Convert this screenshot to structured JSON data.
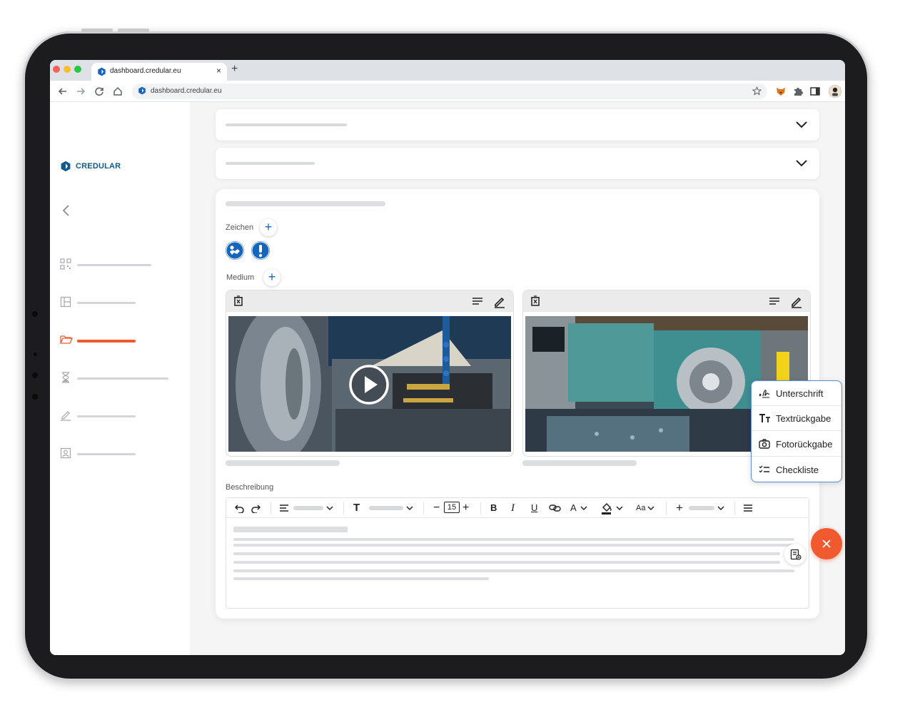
{
  "browser": {
    "tab_title": "dashboard.credular.eu",
    "url": "dashboard.credular.eu",
    "new_tab": "+",
    "close_tab": "×"
  },
  "sidebar": {
    "logo_text": "CREDULAR",
    "items": [
      {
        "icon": "qr-code-icon",
        "active": false
      },
      {
        "icon": "layout-icon",
        "active": false
      },
      {
        "icon": "folder-open-icon",
        "active": true
      },
      {
        "icon": "hourglass-icon",
        "active": false
      },
      {
        "icon": "signature-pen-icon",
        "active": false
      },
      {
        "icon": "id-card-icon",
        "active": false
      }
    ],
    "active_color": "#f15a2e"
  },
  "card": {
    "signs_label": "Zeichen",
    "medium_label": "Medium",
    "description_label": "Beschreibung",
    "add_symbol": "+",
    "signs": [
      "ppe-sign-icon",
      "warning-sign-icon"
    ],
    "media": [
      {
        "type": "video",
        "icons": [
          "delete-icon",
          "text-lines-icon",
          "edit-pencil-icon"
        ]
      },
      {
        "type": "image",
        "icons": [
          "delete-icon",
          "text-lines-icon",
          "edit-pencil-icon"
        ]
      }
    ]
  },
  "editor": {
    "font_size": "15",
    "bold": "B",
    "italic": "I",
    "underline": "U",
    "font_color": "A",
    "case": "Aa",
    "text_icon": "T",
    "minus": "−",
    "plus": "+"
  },
  "popup_menu": {
    "items": [
      {
        "label": "Unterschrift",
        "icon": "signature-icon"
      },
      {
        "label": "Textrückgabe",
        "icon": "text-size-icon"
      },
      {
        "label": "Fotorückgabe",
        "icon": "camera-icon"
      },
      {
        "label": "Checkliste",
        "icon": "checklist-icon"
      }
    ]
  },
  "colors": {
    "brand_blue": "#1565c0",
    "accent_orange": "#f15a2e"
  }
}
